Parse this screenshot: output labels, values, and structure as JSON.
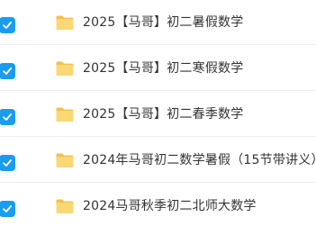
{
  "file_list": {
    "items": [
      {
        "name": "2025【马哥】初二暑假数学",
        "type": "folder",
        "selected": true,
        "icon": "folder-icon"
      },
      {
        "name": "2025【马哥】初二寒假数学",
        "type": "folder",
        "selected": true,
        "icon": "folder-icon"
      },
      {
        "name": "2025【马哥】初二春季数学",
        "type": "folder",
        "selected": true,
        "icon": "folder-icon"
      },
      {
        "name": "2024年马哥初二数学暑假（15节带讲义）",
        "type": "folder",
        "selected": true,
        "icon": "folder-icon"
      },
      {
        "name": "2024马哥秋季初二北师大数学",
        "type": "folder",
        "selected": true,
        "icon": "folder-icon"
      }
    ]
  },
  "colors": {
    "checkbox": "#1a9cf0",
    "folder": "#f7c95a",
    "text": "#333333"
  }
}
